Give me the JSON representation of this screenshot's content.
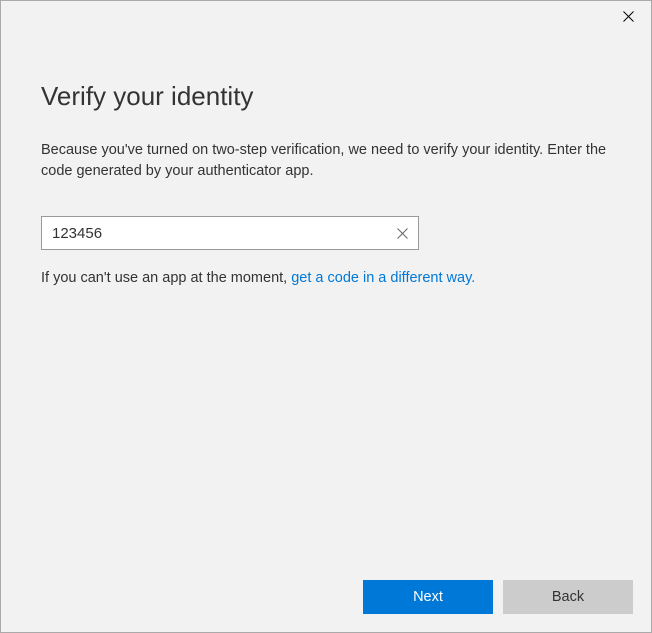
{
  "title": "Verify your identity",
  "description": "Because you've turned on two-step verification, we need to verify your identity. Enter the code generated by your authenticator app.",
  "code_input": {
    "value": "123456"
  },
  "help": {
    "prefix": "If you can't use an app at the moment, ",
    "link": "get a code in a different way."
  },
  "buttons": {
    "next": "Next",
    "back": "Back"
  }
}
